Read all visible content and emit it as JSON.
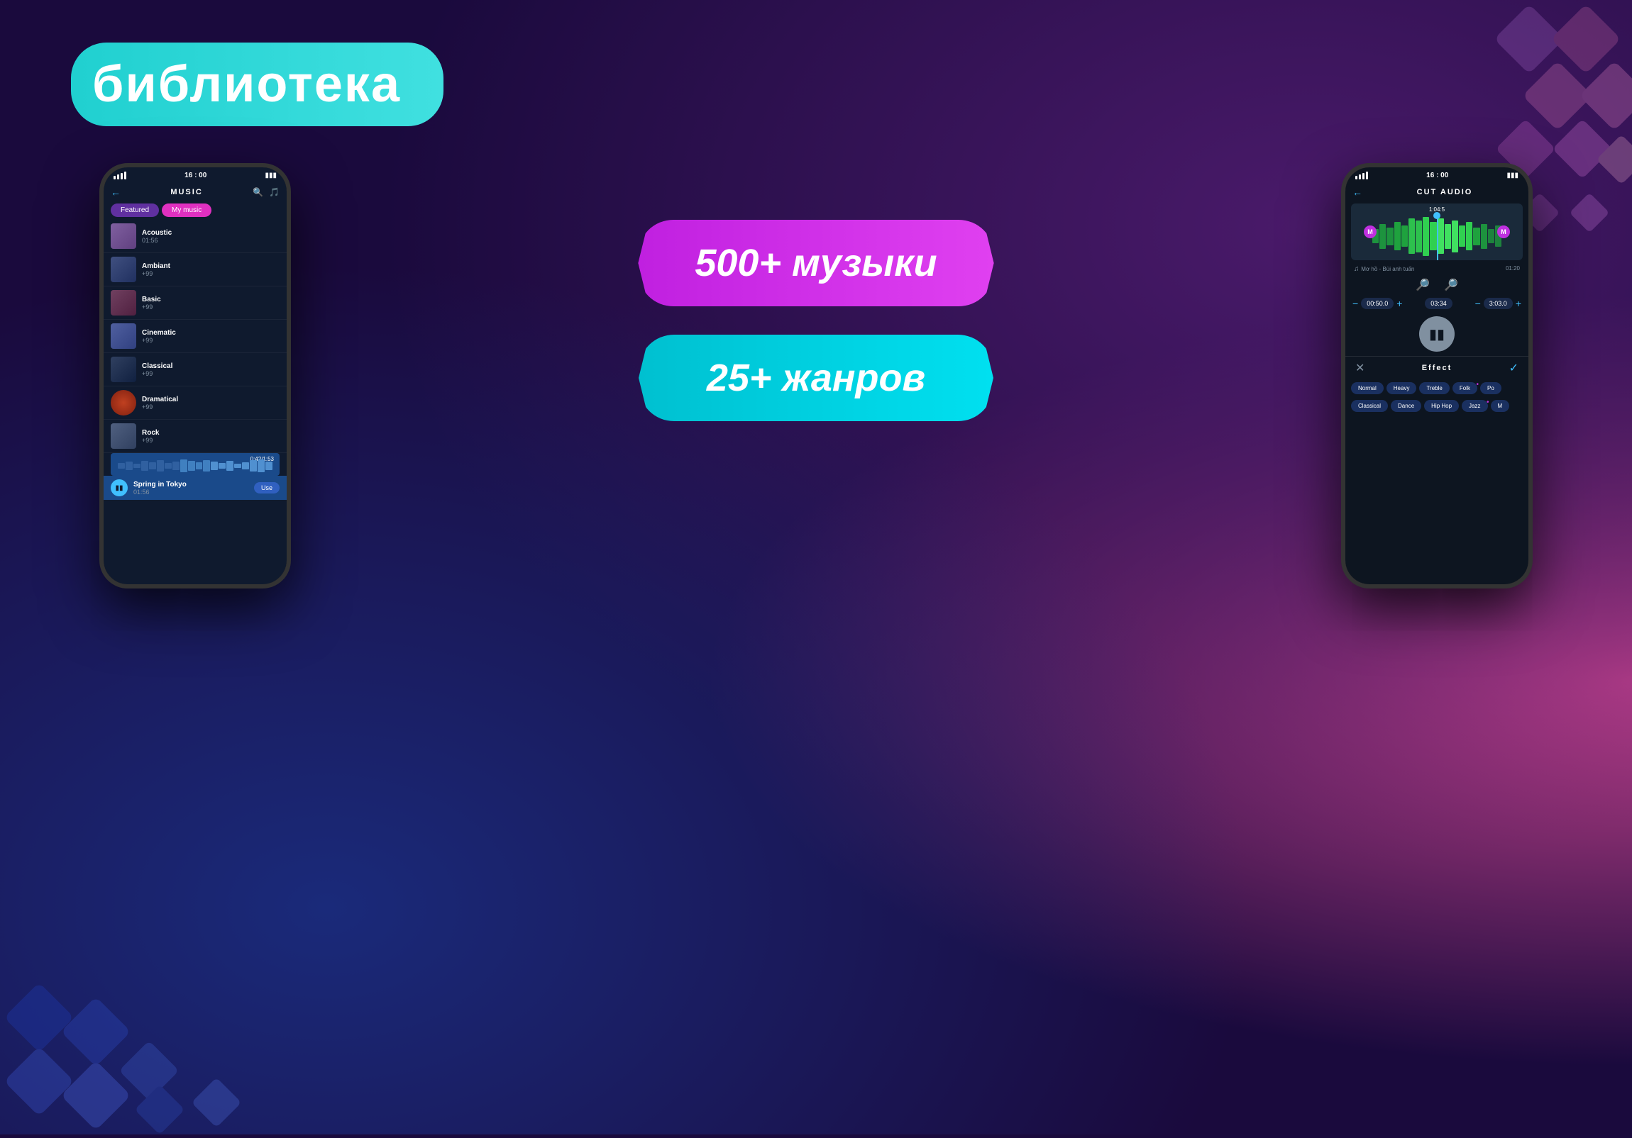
{
  "title": "библиотека",
  "background": {
    "primary": "#1a0a3d",
    "accent1": "#1a2a7a",
    "accent2": "#4a1a6a",
    "accent3": "#c0408a"
  },
  "stats": {
    "music_count": "500+ музыки",
    "genre_count": "25+ жанров",
    "music_color": "#c020e0",
    "genre_color": "#00c0d0"
  },
  "phone1": {
    "status": {
      "time": "16 : 00",
      "battery": "▮▮▮"
    },
    "header_title": "MUSIC",
    "tabs": {
      "featured": "Featured",
      "my_music": "My music"
    },
    "music_items": [
      {
        "name": "Acoustic",
        "meta": "01:56",
        "color": "#8060a0"
      },
      {
        "name": "Ambiant",
        "meta": "+99",
        "color": "#405080"
      },
      {
        "name": "Basic",
        "meta": "+99",
        "color": "#704060"
      },
      {
        "name": "Cinematic",
        "meta": "+99",
        "color": "#5060a0"
      },
      {
        "name": "Classical",
        "meta": "+99",
        "color": "#304060"
      },
      {
        "name": "Dramatical",
        "meta": "+99",
        "color": "#c04020"
      },
      {
        "name": "Rock",
        "meta": "+99",
        "color": "#506080"
      }
    ],
    "playing": {
      "progress": "0:42/1:53",
      "track": "Spring in Tokyo",
      "duration": "01:56"
    }
  },
  "phone2": {
    "status": {
      "time": "16 : 00",
      "battery": "▮▮▮"
    },
    "header_title": "CUT AUDIO",
    "waveform": {
      "timestamp": "1:04:5",
      "track_name": "Mơ hồ - Bùi anh tuấn",
      "total_duration": "01:20"
    },
    "time_controls": {
      "start": "00:50.0",
      "middle": "03:34",
      "end": "3:03.0"
    },
    "effect_title": "Effect",
    "effects_row1": [
      "Normal",
      "Heavy",
      "Treble",
      "Folk",
      "Po"
    ],
    "effects_row2": [
      "Classical",
      "Dance",
      "Hip Hop",
      "Jazz",
      "M"
    ]
  }
}
